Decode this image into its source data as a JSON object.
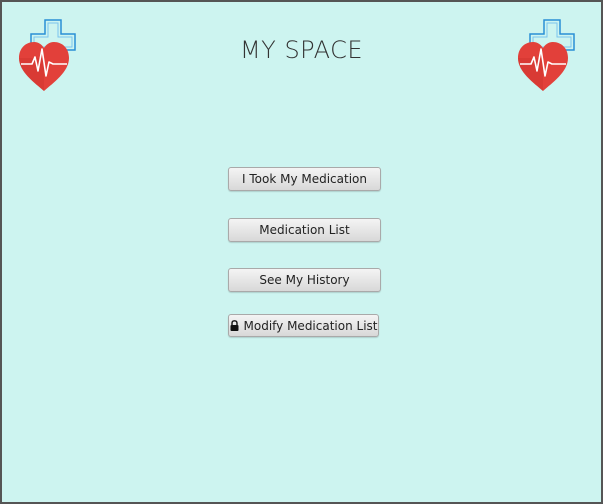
{
  "app": {
    "title": "MY SPACE"
  },
  "logos": {
    "left_icon": "heart-medical-cross",
    "right_icon": "heart-medical-cross"
  },
  "menu": {
    "took_medication_label": "I Took My Medication",
    "medication_list_label": "Medication List",
    "history_label": "See My History",
    "modify_list_label": "Modify Medication List",
    "modify_list_icon": "lock-icon"
  },
  "colors": {
    "background": "#cdf4f0",
    "heart": "#e2403a",
    "cross": "#2a8fd6"
  }
}
